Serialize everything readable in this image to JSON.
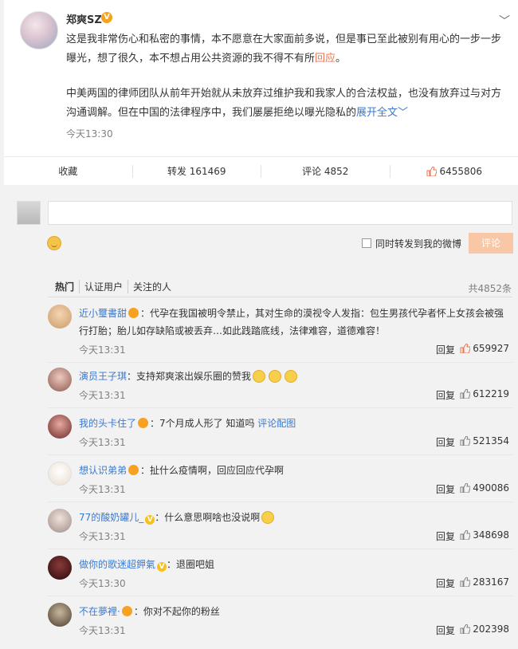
{
  "post": {
    "author": "郑爽SZ",
    "verified_badge": "V",
    "text1": "这是我非常伤心和私密的事情，本不愿意在大家面前多说，但是事已至此被别有用心的一步一步曝光，想了很久，本不想占用公共资源的我不得不有所",
    "text1_link": "回应",
    "text1_end": "。",
    "text2": "中美两国的律师团队从前年开始就从未放弃过维护我和我家人的合法权益，也没有放弃过与对方沟通调解。但在中国的法律程序中，我们屡屡拒绝以曝光隐私的",
    "expand": "展开全文",
    "time": "今天13:30"
  },
  "actions": {
    "favorite": "收藏",
    "forward": "转发 161469",
    "comment": "评论 4852",
    "like": "6455806"
  },
  "composer": {
    "forward_label": "同时转发到我的微博",
    "submit": "评论"
  },
  "tabs": [
    "热门",
    "认证用户",
    "关注的人"
  ],
  "total": "共4852条",
  "reply_label": "回复",
  "comments": [
    {
      "name": "近小璽書甜",
      "text": "：代孕在我国被明令禁止，其对生命的漠视令人发指：包生男孩代孕者怀上女孩会被强行打胎；胎儿如存缺陷或被丢弃…如此践踏底线，法律难容，道德难容！",
      "time": "今天13:31",
      "likes": "659927"
    },
    {
      "name": "演员王子琪",
      "text": "：支持郑爽滚出娱乐圈的赞我",
      "time": "今天13:31",
      "likes": "612219"
    },
    {
      "name": "我的头卡住了",
      "text": "：7个月成人形了 知道吗",
      "link": "评论配图",
      "time": "今天13:31",
      "likes": "521354"
    },
    {
      "name": "想认识弟弟",
      "text": "：扯什么疫情啊，回应回应代孕啊",
      "time": "今天13:31",
      "likes": "490086"
    },
    {
      "name": "77的酸奶罐儿_",
      "vbadge": "V",
      "text": "：什么意思啊啥也没说啊",
      "time": "今天13:31",
      "likes": "348698"
    },
    {
      "name": "做你的歌迷超鉀氣",
      "vbadge": "V",
      "text": "：退圈吧姐",
      "time": "今天13:30",
      "likes": "283167"
    },
    {
      "name": "不在夢裡·",
      "text": "：你对不起你的粉丝",
      "time": "今天13:31",
      "likes": "202398"
    }
  ],
  "colors": {
    "accent": "#eb7350",
    "link": "#3a7ad1",
    "badge": "#f7a120"
  }
}
